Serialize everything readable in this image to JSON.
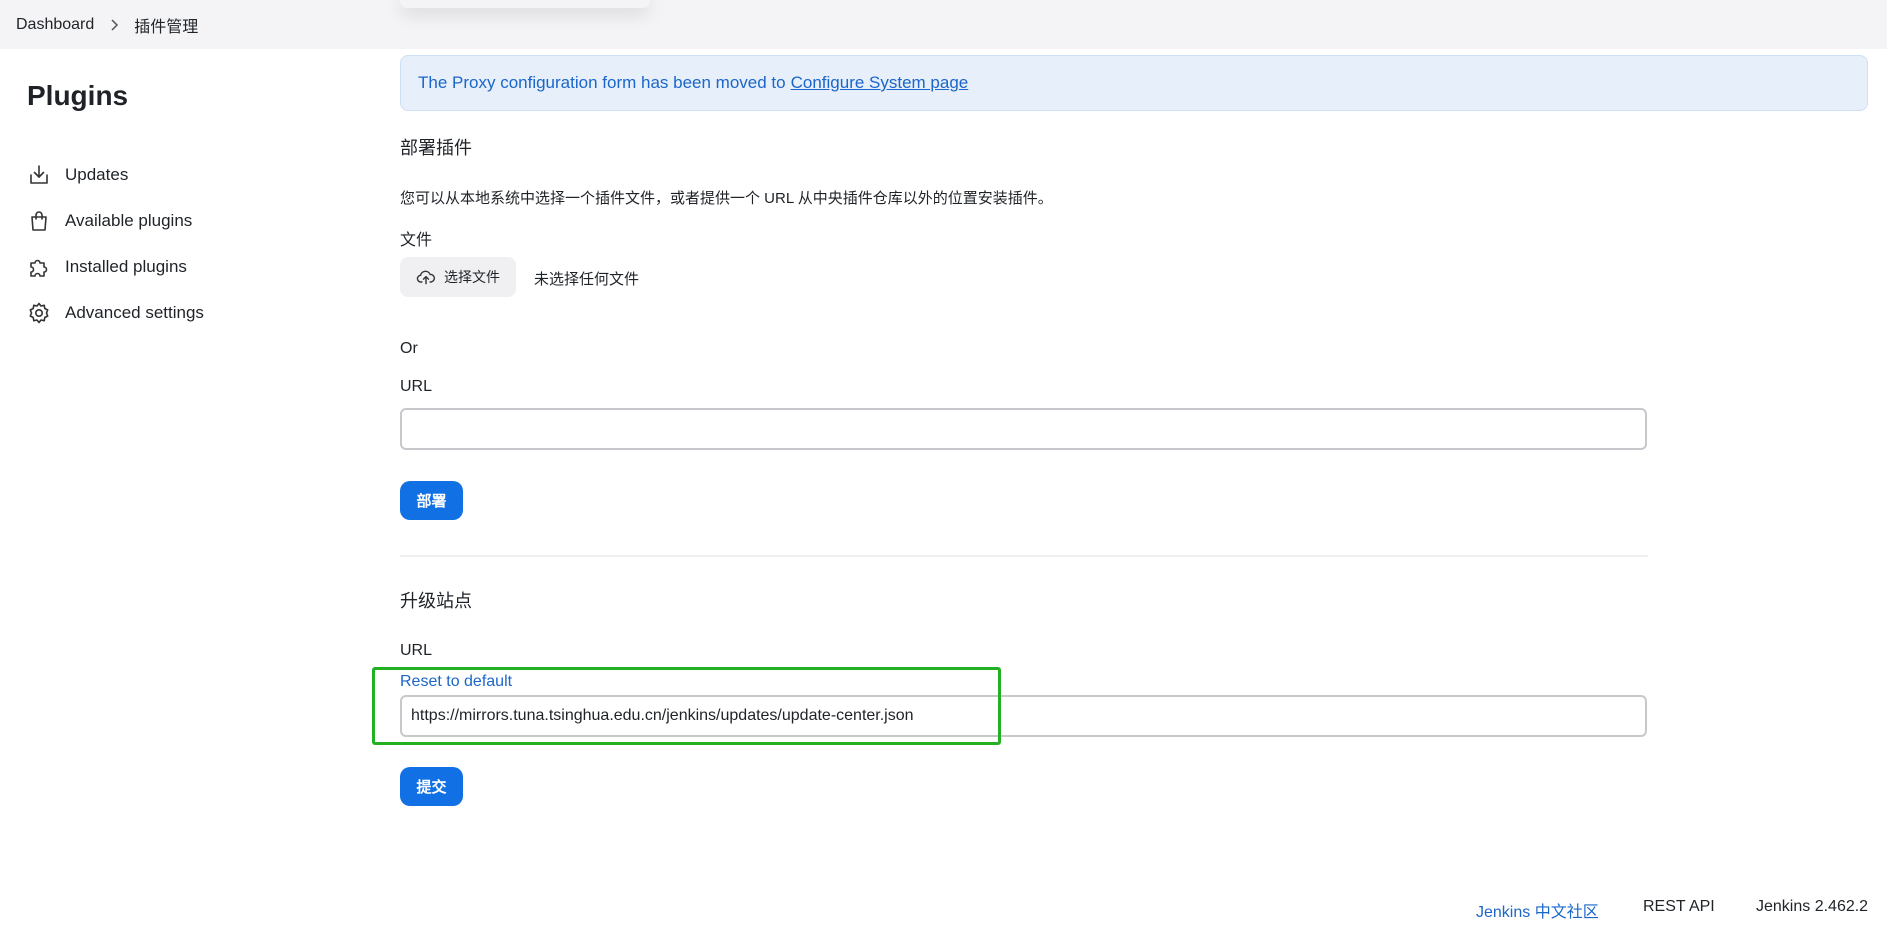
{
  "breadcrumb": {
    "root": "Dashboard",
    "current": "插件管理"
  },
  "sidebar": {
    "title": "Plugins",
    "items": [
      {
        "label": "Updates",
        "icon": "download-icon"
      },
      {
        "label": "Available plugins",
        "icon": "shopping-bag-icon"
      },
      {
        "label": "Installed plugins",
        "icon": "puzzle-icon"
      },
      {
        "label": "Advanced settings",
        "icon": "gear-icon"
      }
    ]
  },
  "notice": {
    "text": "The Proxy configuration form has been moved to",
    "link_text": "Configure System page"
  },
  "deploy": {
    "title": "部署插件",
    "description": "您可以从本地系统中选择一个插件文件，或者提供一个 URL 从中央插件仓库以外的位置安装插件。",
    "file_label": "文件",
    "choose_file_label": "选择文件",
    "file_status": "未选择任何文件",
    "or_label": "Or",
    "url_label": "URL",
    "url_value": "",
    "submit_label": "部署"
  },
  "update_site": {
    "title": "升级站点",
    "url_label": "URL",
    "reset_label": "Reset to default",
    "url_value": "https://mirrors.tuna.tsinghua.edu.cn/jenkins/updates/update-center.json",
    "submit_label": "提交"
  },
  "footer": {
    "community_link": "Jenkins 中文社区",
    "rest_api": "REST API",
    "version": "Jenkins 2.462.2"
  },
  "colors": {
    "accent": "#1170e4",
    "link": "#1b66c9",
    "notice_bg": "#e6effa",
    "highlight": "#23b023"
  }
}
